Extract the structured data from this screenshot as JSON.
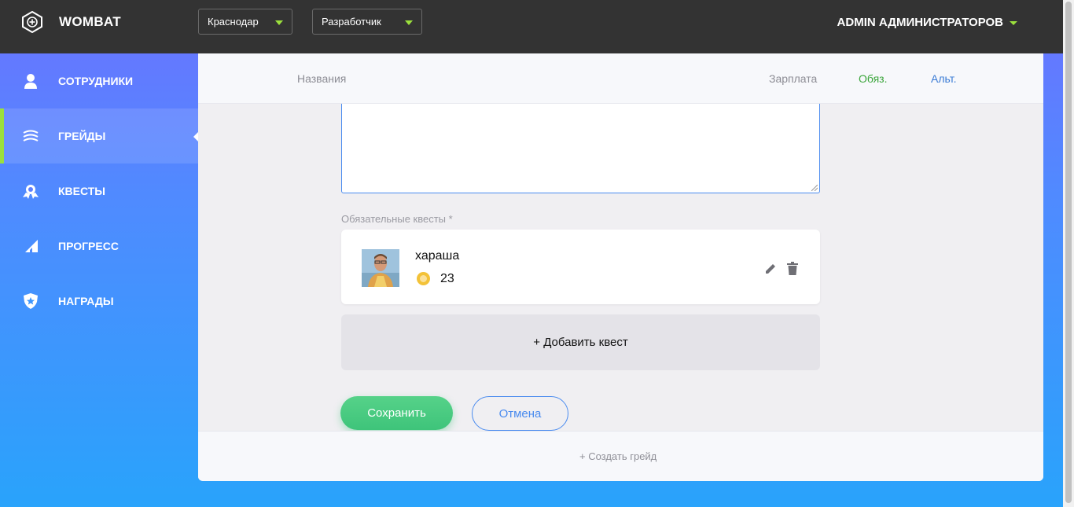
{
  "header": {
    "app_name": "WOMBAT",
    "city_select": "Краснодар",
    "role_select": "Разработчик",
    "user_name": "ADMIN АДМИНИСТРАТОРОВ"
  },
  "sidebar": {
    "items": [
      {
        "label": "СОТРУДНИКИ",
        "icon": "user-icon"
      },
      {
        "label": "ГРЕЙДЫ",
        "icon": "layers-icon",
        "active": true
      },
      {
        "label": "КВЕСТЫ",
        "icon": "medal-icon"
      },
      {
        "label": "ПРОГРЕСС",
        "icon": "signal-icon"
      },
      {
        "label": "НАГРАДЫ",
        "icon": "shield-star-icon"
      }
    ]
  },
  "table_header": {
    "name": "Названия",
    "salary": "Зарплата",
    "required": "Обяз.",
    "alternative": "Альт."
  },
  "form": {
    "description_value": "",
    "required_quests_label": "Обязательные квесты *",
    "quests": [
      {
        "title": "хараша",
        "points": "23"
      }
    ],
    "add_quest_label": "+ Добавить квест",
    "save_label": "Сохранить",
    "cancel_label": "Отмена"
  },
  "footer": {
    "create_grade_label": "+ Создать грейд"
  },
  "colors": {
    "accent_green": "#9be03d",
    "required_green": "#3aa53a",
    "alt_blue": "#3a7bd5",
    "save_button": "#4ecb82",
    "cancel_border": "#4a8bef",
    "topbar": "#333333"
  }
}
